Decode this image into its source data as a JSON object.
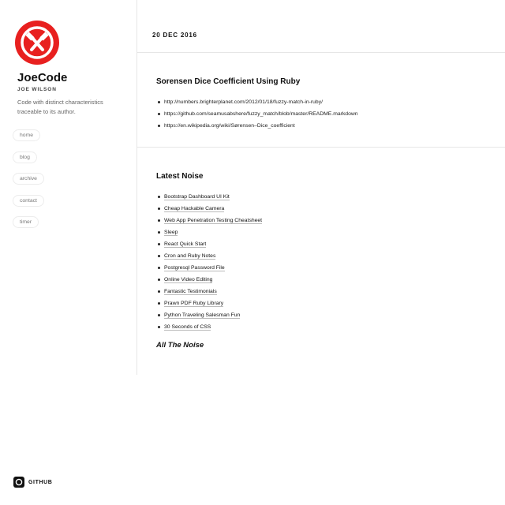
{
  "site": {
    "title": "JoeCode",
    "author": "JOE WILSON",
    "tagline": "Code with distinct characteristics traceable to its author.",
    "accent_color": "#e8201f",
    "logo_icon": "crossed-hammers-icon"
  },
  "nav": [
    {
      "label": "home"
    },
    {
      "label": "blog"
    },
    {
      "label": "archive"
    },
    {
      "label": "contact"
    },
    {
      "label": "timer"
    }
  ],
  "header": {
    "date": "20 DEC 2016"
  },
  "post": {
    "title": "Sorensen Dice Coefficient Using Ruby",
    "links": [
      "http://numbers.brighterplanet.com/2012/01/18/fuzzy-match-in-ruby/",
      "https://github.com/seamusabshere/fuzzy_match/blob/master/README.markdown",
      "https://en.wikipedia.org/wiki/Sørensen–Dice_coefficient"
    ]
  },
  "noise": {
    "title": "Latest Noise",
    "items": [
      "Bootstrap Dashboard UI Kit",
      "Cheap Hackable Camera",
      "Web App Penetration Testing Cheatsheet",
      "Sleep",
      "React Quick Start",
      "Cron and Ruby Notes",
      "Postgresql Password File",
      "Online Video Editing",
      "Fantastic Testimonials",
      "Prawn PDF Ruby Library",
      "Python Traveling Salesman Fun",
      "30 Seconds of CSS"
    ],
    "all_link": "All The Noise"
  },
  "footer": {
    "github_label": "GITHUB",
    "github_icon": "github-icon"
  }
}
